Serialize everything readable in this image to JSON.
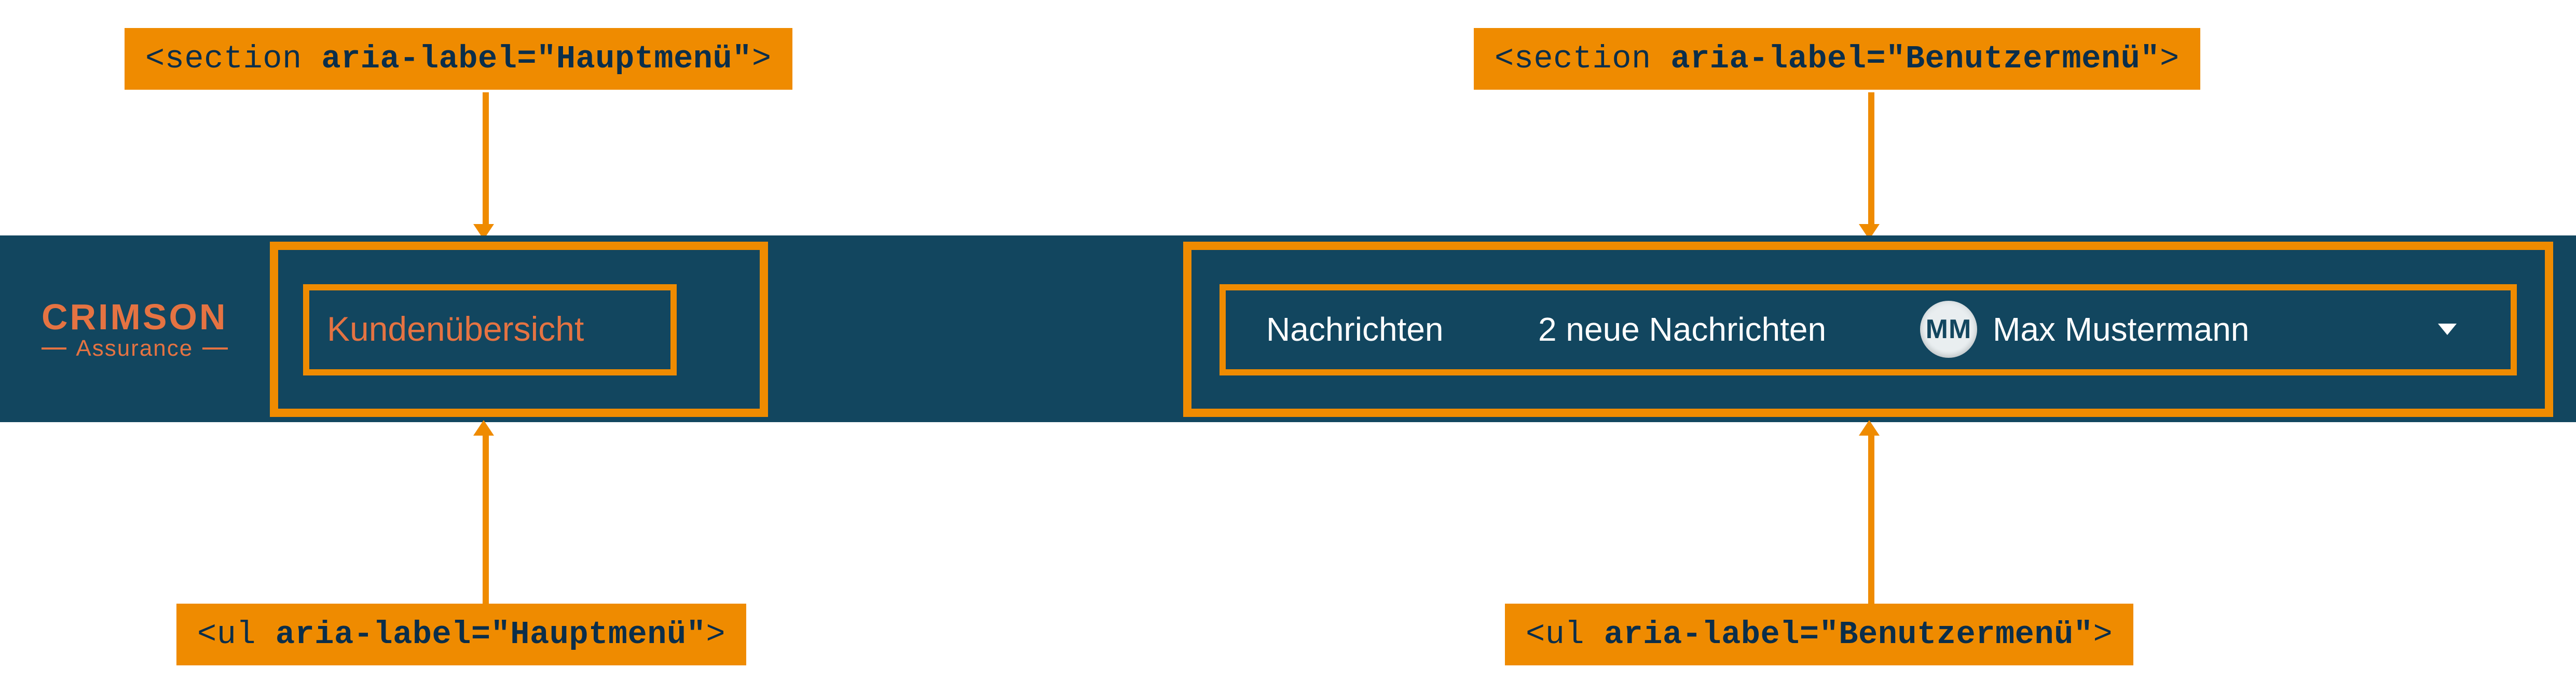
{
  "logo": {
    "main": "CRIMSON",
    "sub": "Assurance"
  },
  "mainMenu": {
    "items": [
      {
        "label": "Kundenübersicht"
      }
    ]
  },
  "userMenu": {
    "messagesLabel": "Nachrichten",
    "notificationText": "2 neue Nachrichten",
    "avatarInitials": "MM",
    "userName": "Max Mustermann"
  },
  "annotations": {
    "sectionHauptmenu": {
      "tag": "<section ",
      "attr": "aria-label=\"Hauptmenü\"",
      "close": ">"
    },
    "sectionBenutzermenu": {
      "tag": "<section ",
      "attr": "aria-label=\"Benutzermenü\"",
      "close": ">"
    },
    "ulHauptmenu": {
      "tag": "<ul ",
      "attr": "aria-label=\"Hauptmenü\"",
      "close": ">"
    },
    "ulBenutzermenu": {
      "tag": "<ul ",
      "attr": "aria-label=\"Benutzermenü\"",
      "close": ">"
    }
  }
}
